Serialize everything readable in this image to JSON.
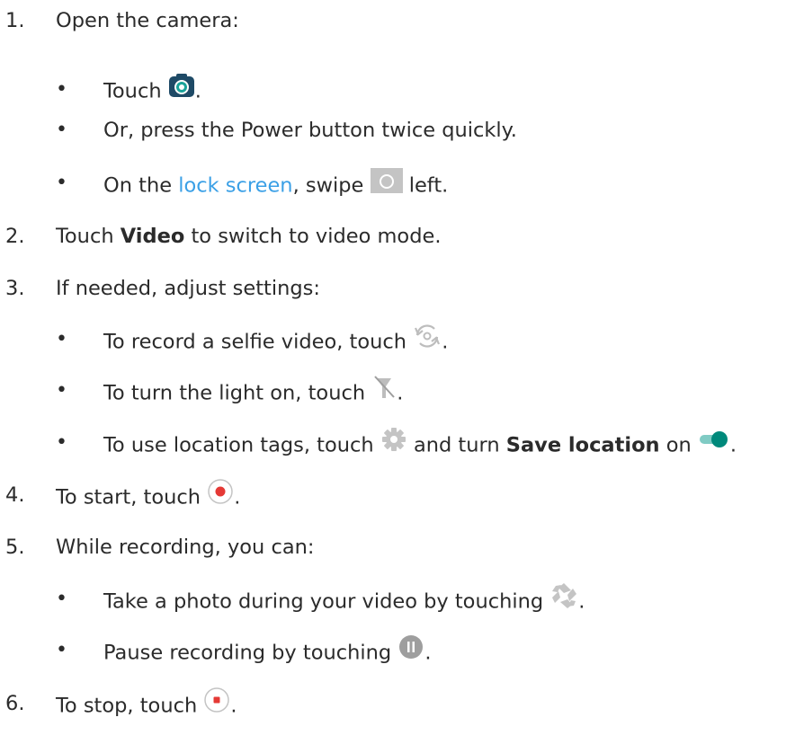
{
  "steps": [
    {
      "num": "1.",
      "text": "Open the camera:"
    },
    {
      "num": "2.",
      "before": "Touch ",
      "bold": "Video",
      "after": " to switch to video mode."
    },
    {
      "num": "3.",
      "text": "If needed, adjust settings:"
    },
    {
      "num": "4.",
      "before": "To start, touch ",
      "after": "."
    },
    {
      "num": "5.",
      "text": "While recording, you can:"
    },
    {
      "num": "6.",
      "before": "To stop, touch ",
      "after": "."
    }
  ],
  "step1_bullets": [
    {
      "before": "Touch ",
      "after": "."
    },
    {
      "text": "Or, press the Power button twice quickly."
    },
    {
      "before": "On the ",
      "link": "lock screen",
      "mid": ", swipe ",
      "after": " left."
    }
  ],
  "step3_bullets": [
    {
      "before": "To record a selfie video, touch ",
      "after": "."
    },
    {
      "before": "To turn the light on, touch ",
      "after": "."
    },
    {
      "before": "To use location tags, touch ",
      "mid": " and turn ",
      "bold": "Save location",
      "mid2": " on ",
      "after": "."
    }
  ],
  "step5_bullets": [
    {
      "before": "Take a photo during your video by touching ",
      "after": "."
    },
    {
      "before": "Pause recording by touching ",
      "after": "."
    }
  ],
  "bullet_glyph": "•",
  "icons": {
    "camera_app": "camera-app-icon",
    "lock_camera": "lock-screen-camera-icon",
    "switch_camera": "switch-camera-icon",
    "flash_off": "flash-off-icon",
    "settings": "settings-gear-icon",
    "toggle_on": "toggle-on-icon",
    "record": "record-icon",
    "capture_photo": "shutter-icon",
    "pause": "pause-icon",
    "stop": "stop-icon"
  },
  "colors": {
    "text": "#2b2b2b",
    "link": "#3ba0e6",
    "record_red": "#e53935",
    "toggle_teal": "#00897b",
    "icon_grey": "#bdbdbd"
  }
}
